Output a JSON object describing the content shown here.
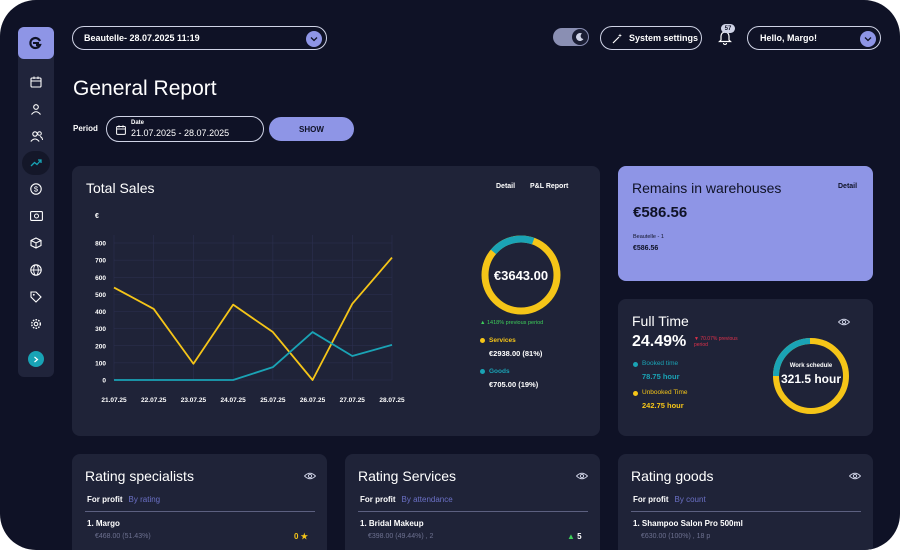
{
  "header": {
    "branch_select": "Beautelle- 28.07.2025 11:19",
    "system_settings": "System settings",
    "notification_count": "57",
    "user_greeting": "Hello, Margo!"
  },
  "page": {
    "title": "General Report",
    "period_label": "Period",
    "date_caption": "Date",
    "date_range": "21.07.2025 - 28.07.2025",
    "show_button": "SHOW"
  },
  "sidebar": {
    "items": [
      "calendar-icon",
      "user-icon",
      "users-icon",
      "trending-up-icon",
      "dollar-icon",
      "cash-icon",
      "box-icon",
      "globe-icon",
      "tag-icon",
      "gear-icon"
    ]
  },
  "total_sales": {
    "title": "Total Sales",
    "detail_link": "Detail",
    "pl_report_link": "P&L Report",
    "currency_label": "€",
    "total_value": "€3643.00",
    "growth_note": "1418% previous period",
    "services_label": "Services",
    "services_value": "€2938.00 (81%)",
    "goods_label": "Goods",
    "goods_value": "€705.00 (19%)"
  },
  "chart_data": {
    "type": "line",
    "x": [
      "21.07.25",
      "22.07.25",
      "23.07.25",
      "24.07.25",
      "25.07.25",
      "26.07.25",
      "27.07.25",
      "28.07.25"
    ],
    "yticks": [
      0,
      100,
      200,
      300,
      400,
      500,
      600,
      700,
      800
    ],
    "ylim": [
      0,
      800
    ],
    "ylabel": "€",
    "grid": true,
    "series": [
      {
        "color": "#f5c518",
        "values": [
          540,
          415,
          95,
          440,
          280,
          0,
          445,
          715
        ]
      },
      {
        "color": "#1aa3b5",
        "values": [
          0,
          0,
          0,
          0,
          75,
          280,
          140,
          205
        ]
      }
    ],
    "donut": {
      "services": 2938,
      "goods": 705,
      "services_color": "#f5c518",
      "goods_color": "#1aa3b5"
    }
  },
  "warehouse": {
    "title": "Remains in warehouses",
    "detail_link": "Detail",
    "total": "€586.56",
    "branch_label": "Beautelle - 1",
    "branch_value": "€586.56"
  },
  "full_time": {
    "title": "Full Time",
    "percent": "24.49%",
    "change_note": "70.07% previous period",
    "booked_label": "Booked time",
    "booked_value": "78.75 hour",
    "unbooked_label": "Unbooked Time",
    "unbooked_value": "242.75 hour",
    "ring_caption": "Work schedule",
    "ring_value": "321.5 hour",
    "booked_fraction": 0.2449
  },
  "rating_specialists": {
    "title": "Rating specialists",
    "tab_active": "For profit",
    "tab_inactive": "By rating",
    "row_name": "1. Margo",
    "row_sub": "€468.00 (51.43%)",
    "row_value": "0"
  },
  "rating_services": {
    "title": "Rating Services",
    "tab_active": "For profit",
    "tab_inactive": "By attendance",
    "row_name": "1. Bridal Makeup",
    "row_sub": "€398.00 (49.44%) , 2",
    "row_value": "5"
  },
  "rating_goods": {
    "title": "Rating goods",
    "tab_active": "For profit",
    "tab_inactive": "By count",
    "row_name": "1. Shampoo Salon Pro 500ml",
    "row_sub": "€630.00 (100%) , 18 p"
  },
  "colors": {
    "background": "#0f1226",
    "card": "#1f2338",
    "accent": "#8e95e6",
    "yellow": "#f5c518",
    "teal": "#1aa3b5",
    "green": "#3ecf5a",
    "red": "#e0314b"
  }
}
